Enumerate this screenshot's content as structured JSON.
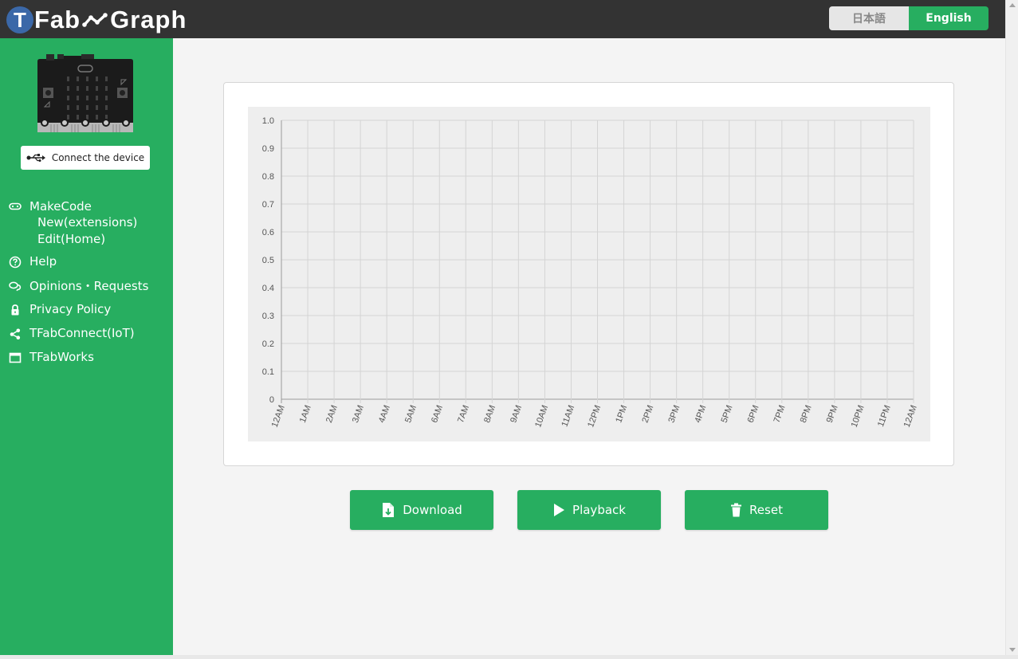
{
  "header": {
    "logo_letter": "T",
    "logo_text_1": "Fab",
    "logo_text_2": "Graph",
    "lang_ja": "日本語",
    "lang_en": "English",
    "accent": "#27ae60",
    "bg": "#333333"
  },
  "sidebar": {
    "device_icon": "microbit-board-icon",
    "connect_label": "Connect the device",
    "makecode": {
      "label": "MakeCode",
      "icon": "gamepad-icon",
      "sub": [
        "New(extensions)",
        "Edit(Home)"
      ]
    },
    "items": [
      {
        "label": "Help",
        "icon": "question-circle-icon"
      },
      {
        "label": "Opinions・Requests",
        "icon": "comments-icon"
      },
      {
        "label": "Privacy Policy",
        "icon": "lock-icon"
      },
      {
        "label": "TFabConnect(IoT)",
        "icon": "share-icon"
      },
      {
        "label": "TFabWorks",
        "icon": "window-icon"
      }
    ]
  },
  "chart_data": {
    "type": "line",
    "title": "",
    "xlabel": "",
    "ylabel": "",
    "ylim": [
      0,
      1.0
    ],
    "yticks": [
      "1.0",
      "0.9",
      "0.8",
      "0.7",
      "0.6",
      "0.5",
      "0.4",
      "0.3",
      "0.2",
      "0.1",
      "0"
    ],
    "x": [
      "12AM",
      "1AM",
      "2AM",
      "3AM",
      "4AM",
      "5AM",
      "6AM",
      "7AM",
      "8AM",
      "9AM",
      "10AM",
      "11AM",
      "12PM",
      "1PM",
      "2PM",
      "3PM",
      "4PM",
      "5PM",
      "6PM",
      "7PM",
      "8PM",
      "9PM",
      "10PM",
      "11PM",
      "12AM"
    ],
    "series": [],
    "grid": true
  },
  "actions": {
    "download": "Download",
    "playback": "Playback",
    "reset": "Reset"
  }
}
